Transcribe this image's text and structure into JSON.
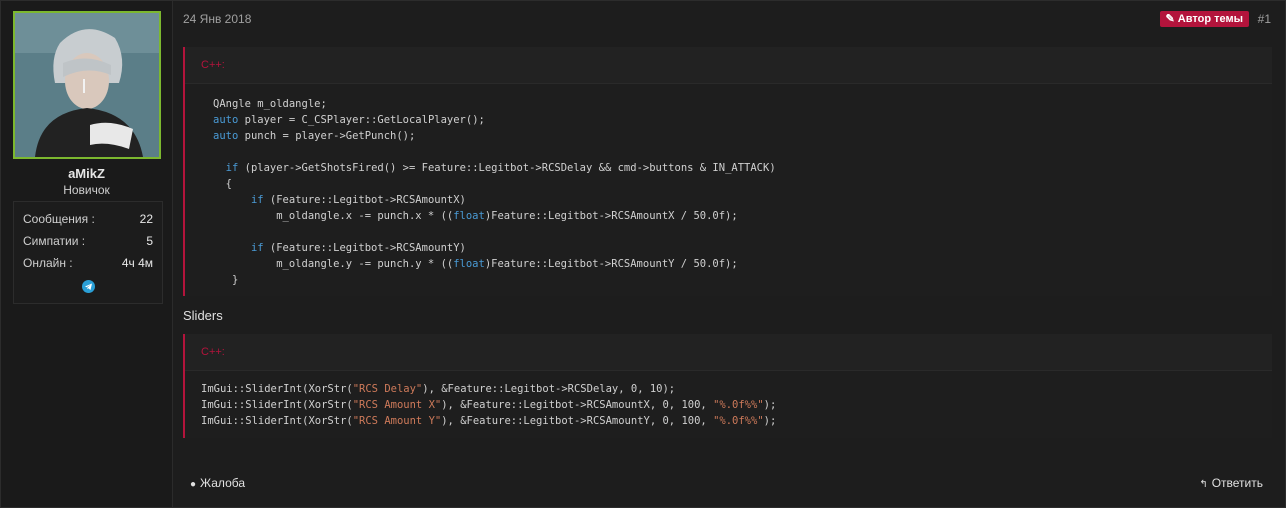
{
  "user": {
    "name": "aMikZ",
    "title": "Новичок",
    "stats": [
      {
        "label": "Сообщения :",
        "value": "22"
      },
      {
        "label": "Симпатии :",
        "value": "5"
      },
      {
        "label": "Онлайн :",
        "value": "4ч 4м"
      }
    ]
  },
  "post": {
    "date": "24 Янв 2018",
    "badge": "Автор темы",
    "number": "#1",
    "sliders_title": "Sliders"
  },
  "code1": {
    "lang": "C++:",
    "lines": [
      "QAngle m_oldangle;",
      "auto player = C_CSPlayer::GetLocalPlayer();",
      "auto punch = player->GetPunch();",
      "",
      "  if (player->GetShotsFired() >= Feature::Legitbot->RCSDelay && cmd->buttons & IN_ATTACK)",
      "  {",
      "      if (Feature::Legitbot->RCSAmountX)",
      "          m_oldangle.x -= punch.x * ((float)Feature::Legitbot->RCSAmountX / 50.0f);",
      "",
      "      if (Feature::Legitbot->RCSAmountY)",
      "          m_oldangle.y -= punch.y * ((float)Feature::Legitbot->RCSAmountY / 50.0f);",
      "   }"
    ]
  },
  "code2": {
    "lang": "C++:",
    "lines": [
      "ImGui::SliderInt(XorStr(\"RCS Delay\"), &Feature::Legitbot->RCSDelay, 0, 10);",
      "ImGui::SliderInt(XorStr(\"RCS Amount X\"), &Feature::Legitbot->RCSAmountX, 0, 100, \"%.0f%%\");",
      "ImGui::SliderInt(XorStr(\"RCS Amount Y\"), &Feature::Legitbot->RCSAmountY, 0, 100, \"%.0f%%\");"
    ]
  },
  "footer": {
    "report": "Жалоба",
    "reply": "Ответить"
  },
  "icons": {
    "badge": "pencil-icon",
    "telegram": "telegram-icon",
    "report": "alert-icon",
    "reply": "reply-icon"
  },
  "colors": {
    "accent": "#b3143c",
    "avatar_border": "#7cb82f",
    "keyword": "#4a9bd6",
    "string": "#ce7a5a"
  }
}
